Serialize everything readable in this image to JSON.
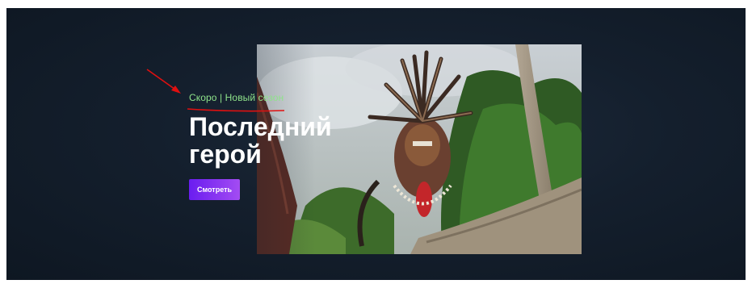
{
  "hero": {
    "tagline": "Скоро | Новый сезон",
    "title": "Последний герой",
    "watch_button_label": "Смотреть"
  },
  "colors": {
    "background": "#141f2d",
    "tagline": "#8fe38a",
    "button_start": "#6a1df0",
    "button_end": "#a34cf2",
    "annotation": "#e01010"
  },
  "icons": {
    "annotation_arrow": "arrow-icon",
    "annotation_underline": "underline-mark"
  }
}
